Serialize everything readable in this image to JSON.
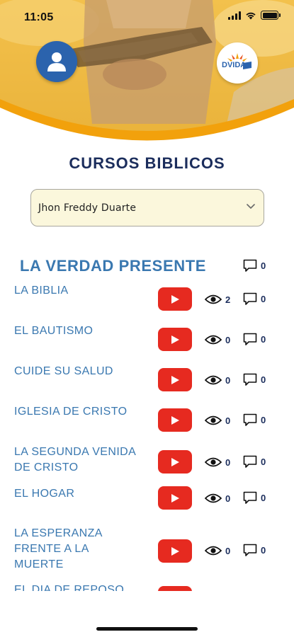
{
  "status_bar": {
    "time": "11:05"
  },
  "header": {
    "profile_icon": "user-icon",
    "logo_text": "DVIDA",
    "accent_color": "#f2a10c",
    "brand_blue": "#2b63ad"
  },
  "page_title": "CURSOS BIBLICOS",
  "student_select": {
    "value": "Jhon Freddy  Duarte"
  },
  "course": {
    "title": "LA VERDAD PRESENTE",
    "comments": "0"
  },
  "lessons": [
    {
      "title": "LA BIBLIA",
      "views": "2",
      "comments": "0"
    },
    {
      "title": "EL BAUTISMO",
      "views": "0",
      "comments": "0"
    },
    {
      "title": "CUIDE SU SALUD",
      "views": "0",
      "comments": "0"
    },
    {
      "title": "IGLESIA DE CRISTO",
      "views": "0",
      "comments": "0"
    },
    {
      "title": "LA SEGUNDA VENIDA DE CRISTO",
      "views": "0",
      "comments": "0"
    },
    {
      "title": "EL HOGAR",
      "views": "0",
      "comments": "0"
    },
    {
      "title": "LA ESPERANZA FRENTE A LA MUERTE",
      "views": "0",
      "comments": "0"
    },
    {
      "title": "EL DIA DE REPOSO",
      "views": "",
      "comments": ""
    }
  ],
  "colors": {
    "play_red": "#e62a20",
    "title_navy": "#1b2d5c",
    "lesson_blue": "#3a78b0"
  }
}
